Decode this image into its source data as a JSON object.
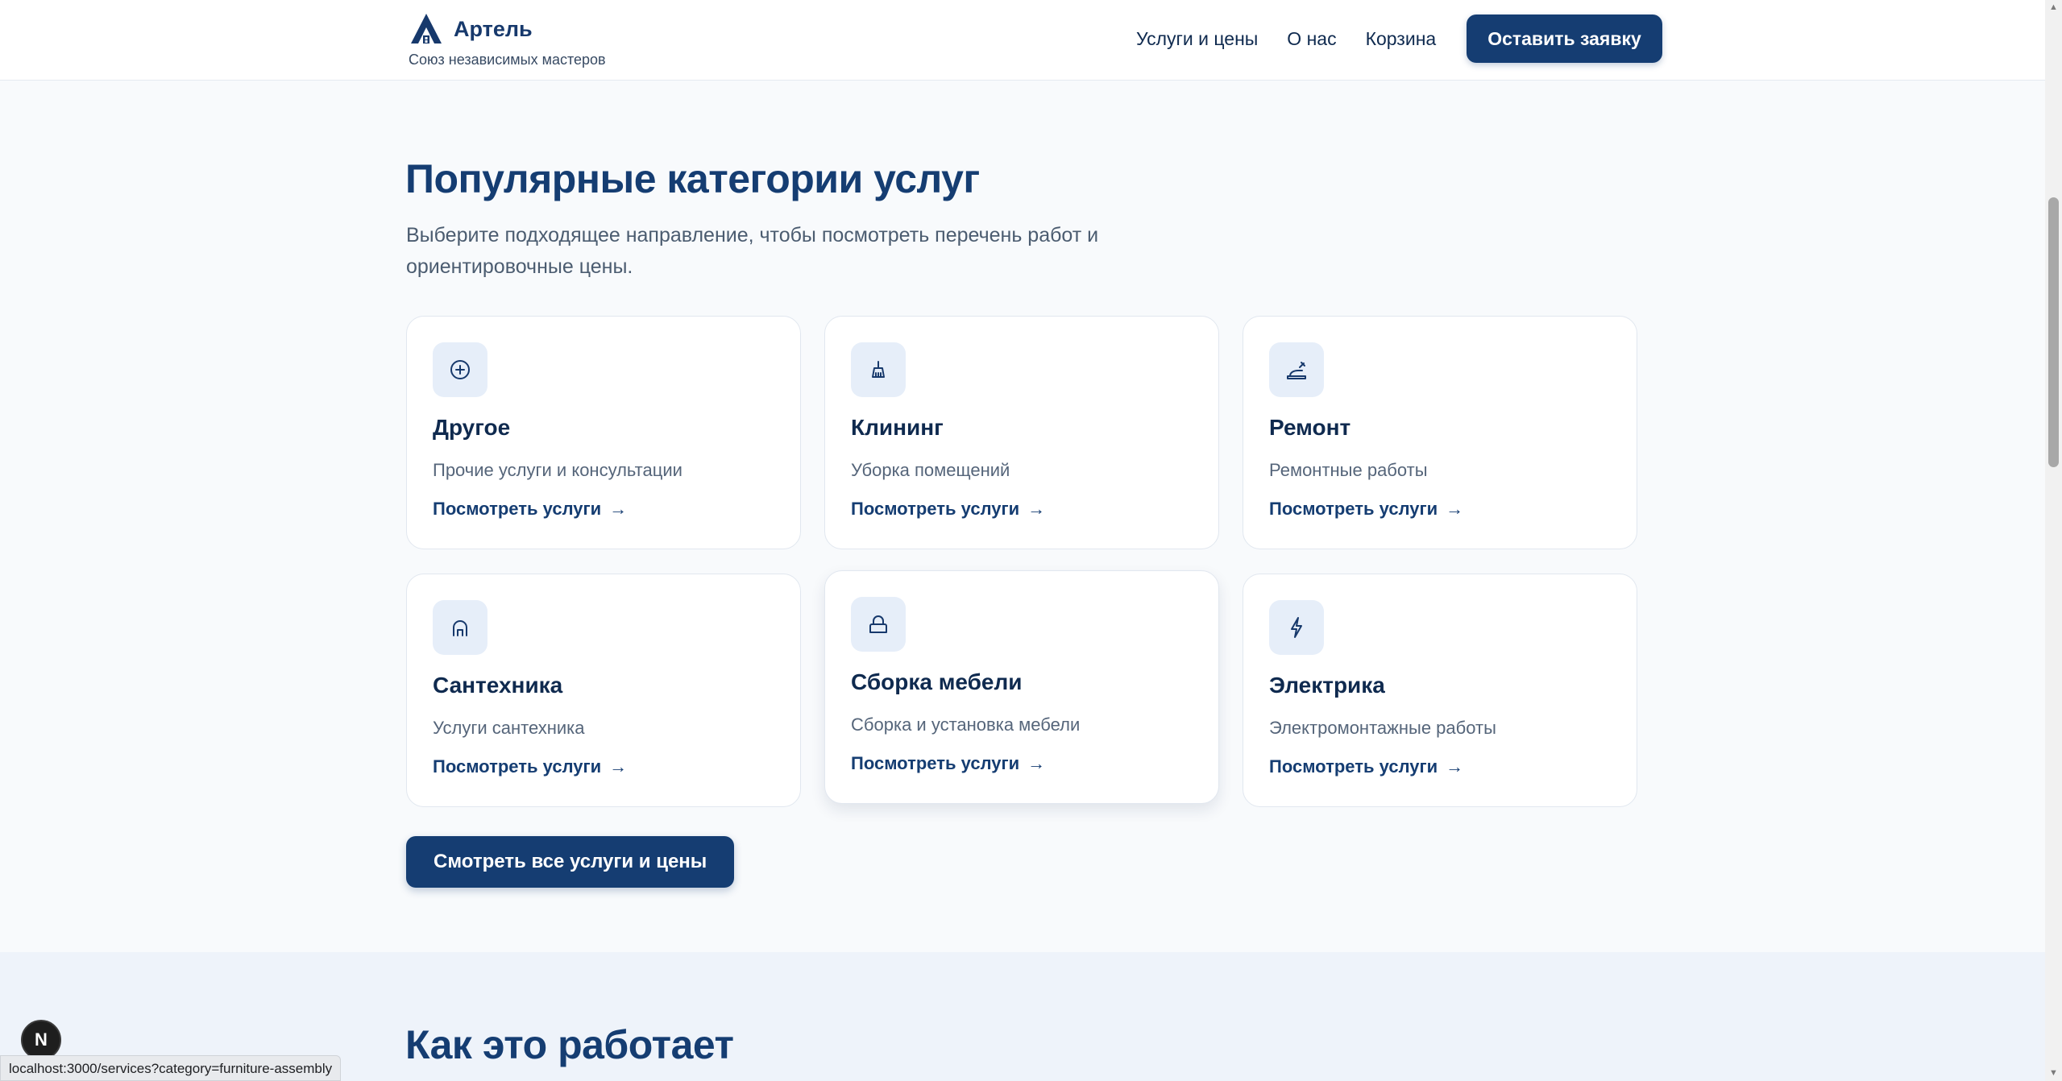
{
  "brand": {
    "name": "Артель",
    "tagline": "Союз независимых мастеров"
  },
  "nav": {
    "items": [
      {
        "label": "Услуги и цены"
      },
      {
        "label": "О нас"
      },
      {
        "label": "Корзина"
      }
    ],
    "cta_label": "Оставить заявку"
  },
  "categories": {
    "title": "Популярные категории услуг",
    "subtitle": "Выберите подходящее направление, чтобы посмотреть перечень работ и ориентировочные цены.",
    "link_label": "Посмотреть услуги",
    "cards": [
      {
        "title": "Другое",
        "description": "Прочие услуги и консультации",
        "icon": "plus-circle-icon"
      },
      {
        "title": "Клининг",
        "description": "Уборка помещений",
        "icon": "broom-icon"
      },
      {
        "title": "Ремонт",
        "description": "Ремонтные работы",
        "icon": "paint-roller-icon"
      },
      {
        "title": "Сантехника",
        "description": "Услуги сантехника",
        "icon": "faucet-icon"
      },
      {
        "title": "Сборка мебели",
        "description": "Сборка и установка мебели",
        "icon": "sofa-icon"
      },
      {
        "title": "Электрика",
        "description": "Электромонтажные работы",
        "icon": "lightning-icon"
      }
    ],
    "all_button_label": "Смотреть все услуги и цены"
  },
  "how_it_works": {
    "title": "Как это работает"
  },
  "dev_badge": {
    "label": "N"
  },
  "status_bar": {
    "url": "localhost:3000/services?category=furniture-assembly"
  },
  "colors": {
    "brand": "#153d72",
    "text": "#0f2a4f",
    "muted": "#55657a",
    "icon_bg": "#e6eef9",
    "page_bg": "#f8fafc"
  }
}
